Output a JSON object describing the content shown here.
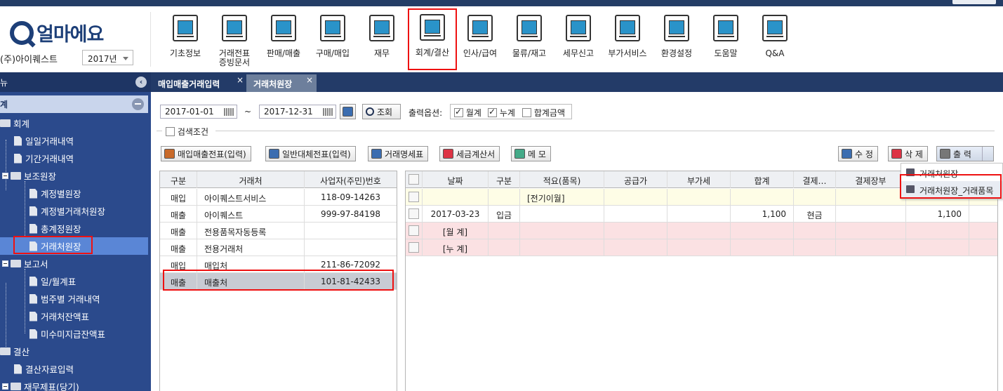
{
  "app": {
    "logo_text": "얼마에요",
    "company": "(주)아이퀘스트",
    "year": "2017년"
  },
  "menus": [
    {
      "label": "기초정보",
      "icon": "basic-info-icon"
    },
    {
      "label": "거래전표\n증빙문서",
      "icon": "voucher-icon"
    },
    {
      "label": "판매/매출",
      "icon": "sales-icon"
    },
    {
      "label": "구매/매입",
      "icon": "purchase-icon"
    },
    {
      "label": "재무",
      "icon": "finance-icon"
    },
    {
      "label": "회계/결산",
      "icon": "accounting-icon"
    },
    {
      "label": "인사/급여",
      "icon": "hr-payroll-icon"
    },
    {
      "label": "물류/재고",
      "icon": "logistics-icon"
    },
    {
      "label": "세무신고",
      "icon": "tax-icon"
    },
    {
      "label": "부가서비스",
      "icon": "addon-service-icon"
    },
    {
      "label": "환경설정",
      "icon": "settings-gear-icon"
    },
    {
      "label": "도움말",
      "icon": "help-icon"
    },
    {
      "label": "Q&A",
      "icon": "qa-icon"
    }
  ],
  "sidebar": {
    "header": "뉴",
    "category": "계",
    "tree": [
      {
        "label": "회계",
        "type": "folder"
      },
      {
        "label": "일일거래내역",
        "type": "doc"
      },
      {
        "label": "기간거래내역",
        "type": "doc"
      },
      {
        "label": "보조원장",
        "type": "folder"
      },
      {
        "label": "계정별원장",
        "type": "doc"
      },
      {
        "label": "계정별거래처원장",
        "type": "doc"
      },
      {
        "label": "총계정원장",
        "type": "doc"
      },
      {
        "label": "거래처원장",
        "type": "doc"
      },
      {
        "label": "보고서",
        "type": "folder"
      },
      {
        "label": "일/월계표",
        "type": "doc"
      },
      {
        "label": "범주별 거래내역",
        "type": "doc"
      },
      {
        "label": "거래처잔액표",
        "type": "doc"
      },
      {
        "label": "미수미지급잔액표",
        "type": "doc"
      },
      {
        "label": "결산",
        "type": "folder"
      },
      {
        "label": "결산자료입력",
        "type": "doc"
      },
      {
        "label": "재무제표(당기)",
        "type": "folder"
      }
    ]
  },
  "tabs": [
    {
      "label": "매입매출거래입력",
      "close": "×"
    },
    {
      "label": "거래처원장",
      "close": "×"
    }
  ],
  "filters": {
    "date_from": "2017-01-01",
    "tilde": "~",
    "date_to": "2017-12-31",
    "search_label": "조회",
    "output_options_label": "출력옵션:",
    "opt_monthly": "월계",
    "opt_cumulative": "누계",
    "opt_total": "합계금액",
    "search_condition": "검색조건"
  },
  "toolbar": {
    "b1": "매입매출전표(입력)",
    "b2": "일반대체전표(입력)",
    "b3": "거래명세표",
    "b4": "세금계산서",
    "b5": "메 모",
    "edit": "수 정",
    "delete": "삭 제",
    "print": "출 력"
  },
  "left_grid": {
    "headers": [
      "구분",
      "거래처",
      "사업자(주민)번호"
    ],
    "rows": [
      [
        "매입",
        "아이퀘스트서비스",
        "118-09-14263"
      ],
      [
        "매출",
        "아이퀘스트",
        "999-97-84198"
      ],
      [
        "매출",
        "전용품목자동등록",
        ""
      ],
      [
        "매출",
        "전용거래처",
        ""
      ],
      [
        "매입",
        "매입처",
        "211-86-72092"
      ],
      [
        "매출",
        "매출처",
        "101-81-42433"
      ]
    ]
  },
  "right_grid": {
    "headers": [
      "",
      "날짜",
      "구분",
      "적요(품목)",
      "공급가",
      "부가세",
      "합계",
      "결제…",
      "결제장부",
      ""
    ],
    "rows": [
      [
        "",
        "",
        "",
        "[전기이월]",
        "",
        "",
        "",
        "",
        "",
        ""
      ],
      [
        "",
        "2017-03-23",
        "입금",
        "",
        "",
        "",
        "1,100",
        "현금",
        "",
        "1,100"
      ],
      [
        "",
        "[월 계]",
        "",
        "",
        "",
        "",
        "",
        "",
        "",
        ""
      ],
      [
        "",
        "[누 계]",
        "",
        "",
        "",
        "",
        "",
        "",
        "",
        ""
      ]
    ]
  },
  "print_menu": {
    "item1": "거래처원장",
    "item2": "거래처원장_거래품목"
  },
  "colors": {
    "accent": "#2b4a8c",
    "highlight_box": "#e11111"
  }
}
